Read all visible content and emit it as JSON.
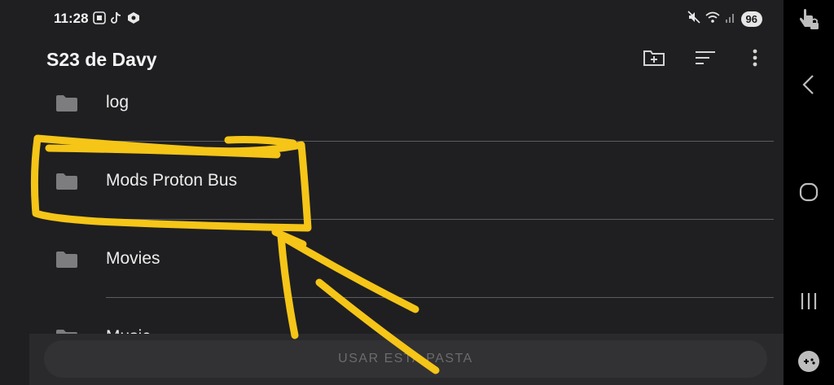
{
  "status_bar": {
    "time": "11:28",
    "battery": "96",
    "icons_left": [
      "screenshot-icon",
      "tiktok-icon",
      "shield-app-icon"
    ],
    "icons_right": [
      "mute-icon",
      "wifi-icon",
      "signal-icon"
    ]
  },
  "app_bar": {
    "title": "S23 de Davy",
    "actions": [
      "new-folder-icon",
      "sort-icon",
      "more-options-icon"
    ]
  },
  "folders": [
    {
      "name": "log"
    },
    {
      "name": "Mods Proton Bus"
    },
    {
      "name": "Movies"
    },
    {
      "name": "Music"
    }
  ],
  "bottom": {
    "button_label": "USAR ESTA PASTA"
  },
  "nav_bar": {
    "buttons": [
      "touch-lock-icon",
      "back-icon",
      "home-icon",
      "recents-icon",
      "game-controller-icon"
    ]
  },
  "colors": {
    "background": "#1f1f21",
    "annotation": "#f5c518",
    "divider": "#5c5c5e"
  }
}
